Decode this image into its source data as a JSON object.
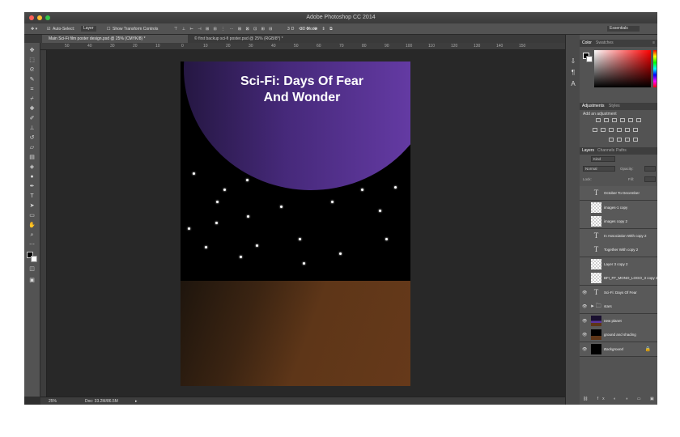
{
  "window": {
    "title": "Adobe Photoshop CC 2014",
    "traffic_lights": [
      "#fc5f57",
      "#fdbc2e",
      "#33c748"
    ]
  },
  "options_bar": {
    "auto_select_label": "Auto-Select:",
    "auto_select_value": "Layer",
    "show_transform_label": "Show Transform Controls",
    "mode_3d_label": "3D Mode:",
    "workspace_value": "Essentials"
  },
  "doc_tabs": [
    {
      "label": "Main Sci-Fi film poster design.psd @ 25% (CMYK/8) *"
    },
    {
      "label": "© first backup sci-fi poster.psd @ 25% (RGB/8*) *"
    }
  ],
  "ruler": {
    "ticks": [
      "50",
      "40",
      "30",
      "20",
      "10",
      "0",
      "10",
      "20",
      "30",
      "40",
      "50",
      "60",
      "70",
      "80",
      "90",
      "100",
      "110",
      "120",
      "130",
      "140",
      "150"
    ]
  },
  "poster": {
    "title_line1": "Sci-Fi: Days Of Fear",
    "title_line2": "And Wonder",
    "colors": {
      "planet": "#5b35a0",
      "ground": "#5e3618",
      "space": "#000000"
    }
  },
  "status": {
    "zoom": "25%",
    "doc_size": "Doc: 33.2M/86.5M"
  },
  "panels": {
    "color_tabs": [
      "Color",
      "Swatches"
    ],
    "adjustments_tabs": [
      "Adjustments",
      "Styles"
    ],
    "adjustments_hint": "Add an adjustment",
    "layers_tabs": [
      "Layers",
      "Channels",
      "Paths"
    ],
    "filter_kind": "Kind",
    "blend_mode": "Normal",
    "opacity_label": "Opacity:",
    "lock_label": "Lock:",
    "fill_label": "Fill:"
  },
  "layers": [
    {
      "name": "October To December",
      "thumb": "text",
      "visible": false
    },
    {
      "name": "images-1 copy",
      "thumb": "checker",
      "visible": false
    },
    {
      "name": "images copy 2",
      "thumb": "checker",
      "visible": false
    },
    {
      "name": "In Association With copy 2",
      "thumb": "text",
      "visible": false
    },
    {
      "name": "Together With copy 2",
      "thumb": "text",
      "visible": false
    },
    {
      "name": "Layer 3 copy 2",
      "thumb": "checker",
      "visible": false
    },
    {
      "name": "BFI_FF_MONO_LOGO_3 copy 2",
      "thumb": "checker",
      "visible": false
    },
    {
      "name": "Sci-Fi: Days Of Fear",
      "thumb": "text",
      "visible": true
    },
    {
      "name": "stars",
      "thumb": "folder",
      "visible": true
    },
    {
      "name": "new planet",
      "thumb": "planet",
      "visible": true
    },
    {
      "name": "ground and shading",
      "thumb": "ground",
      "visible": true
    },
    {
      "name": "Background",
      "thumb": "black",
      "visible": true
    }
  ]
}
